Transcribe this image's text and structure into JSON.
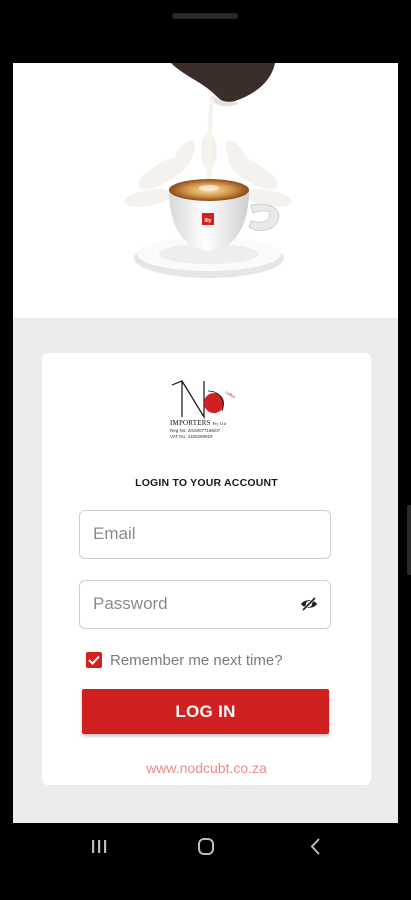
{
  "auth": {
    "heading": "LOGIN TO YOUR ACCOUNT",
    "email_placeholder": "Email",
    "password_placeholder": "Password",
    "remember_label": "Remember me next time?",
    "remember_checked": true,
    "login_label": "LOG IN",
    "website": "www.nodcubt.co.za"
  },
  "logo": {
    "title": "IMPORTERS",
    "suffix": "Pty Ltd",
    "reg": "Reg No: 2019/077186/07",
    "vat": "VAT No: 4150289919"
  },
  "icons": {
    "password_toggle": "eye-off-icon",
    "nav_recents": "recents-icon",
    "nav_home": "home-icon",
    "nav_back": "back-icon"
  },
  "colors": {
    "accent": "#d12020",
    "link": "#ef8a8a",
    "background": "#ececec",
    "card": "#ffffff"
  }
}
